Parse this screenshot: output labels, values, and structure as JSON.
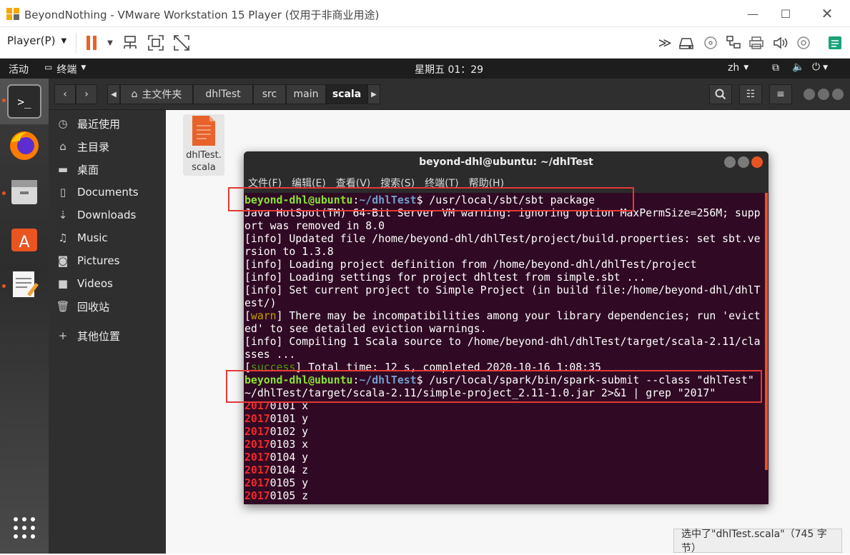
{
  "window": {
    "title": "BeyondNothing - VMware Workstation 15 Player (仅用于非商业用途)"
  },
  "vmware_toolbar": {
    "player_label": "Player(P)"
  },
  "topbar": {
    "activities": "活动",
    "app_menu": "终端",
    "clock": "星期五 01：29",
    "lang": "zh"
  },
  "nautilus": {
    "breadcrumb": [
      "主文件夹",
      "dhlTest",
      "src",
      "main",
      "scala"
    ],
    "sidebar": [
      {
        "label": "最近使用",
        "icon": "clock-icon"
      },
      {
        "label": "主目录",
        "icon": "home-icon"
      },
      {
        "label": "桌面",
        "icon": "folder-icon"
      },
      {
        "label": "Documents",
        "icon": "document-icon"
      },
      {
        "label": "Downloads",
        "icon": "download-icon"
      },
      {
        "label": "Music",
        "icon": "music-icon"
      },
      {
        "label": "Pictures",
        "icon": "camera-icon"
      },
      {
        "label": "Videos",
        "icon": "video-icon"
      },
      {
        "label": "回收站",
        "icon": "trash-icon"
      },
      {
        "label": "其他位置",
        "icon": "plus-icon"
      }
    ],
    "file": {
      "line1": "dhlTest.",
      "line2": "scala"
    },
    "status": "选中了\"dhlTest.scala\"（745 字节）"
  },
  "terminal": {
    "title": "beyond-dhl@ubuntu: ~/dhlTest",
    "menu": [
      "文件(F)",
      "编辑(E)",
      "查看(V)",
      "搜索(S)",
      "终端(T)",
      "帮助(H)"
    ],
    "prompt_user": "beyond-dhl@ubuntu",
    "prompt_path": "~/dhlTest",
    "cmd1": " /usr/local/sbt/sbt package",
    "out1": "Java HotSpot(TM) 64-Bit Server VM warning: ignoring option MaxPermSize=256M; support was removed in 8.0",
    "out2": "[info] Updated file /home/beyond-dhl/dhlTest/project/build.properties: set sbt.version to 1.3.8",
    "out3": "[info] Loading project definition from /home/beyond-dhl/dhlTest/project",
    "out4": "[info] Loading settings for project dhltest from simple.sbt ...",
    "out5": "[info] Set current project to Simple Project (in build file:/home/beyond-dhl/dhlTest/)",
    "warn_tag": "warn",
    "out6": " There may be incompatibilities among your library dependencies; run 'evicted' to see detailed eviction warnings.",
    "out7": "[info] Compiling 1 Scala source to /home/beyond-dhl/dhlTest/target/scala-2.11/classes ...",
    "success_tag": "success",
    "out8": " Total time: 12 s, completed 2020-10-16 1:08:35",
    "cmd2": " /usr/local/spark/bin/spark-submit --class \"dhlTest\" ~/dhlTest/target/scala-2.11/simple-project_2.11-1.0.jar 2>&1 | grep \"2017\"",
    "match": "2017",
    "results": [
      "0101 x",
      "0101 y",
      "0102 y",
      "0103 x",
      "0104 y",
      "0104 z",
      "0105 y",
      "0105 z"
    ]
  }
}
